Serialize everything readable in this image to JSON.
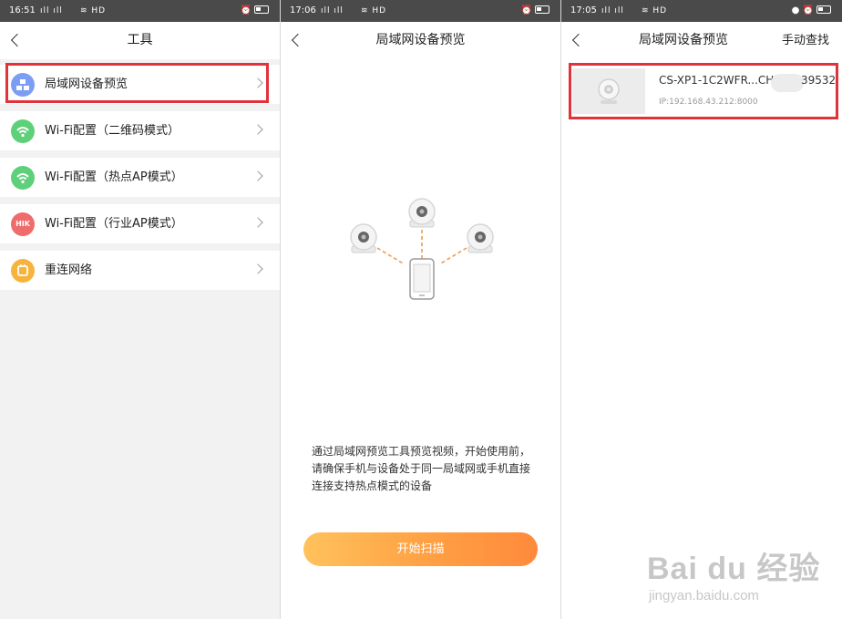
{
  "panels": {
    "left": {
      "status": {
        "time": "16:51",
        "signal": "ıll ıll",
        "right": "⏰"
      },
      "title": "工具",
      "menu": [
        {
          "label": "局域网设备预览",
          "icon": "lan-preview-icon",
          "color": "#7b9df3",
          "highlighted": true
        },
        {
          "label": "Wi-Fi配置（二维码模式）",
          "icon": "wifi-icon",
          "color": "#5ed07a"
        },
        {
          "label": "Wi-Fi配置（热点AP模式）",
          "icon": "wifi-icon",
          "color": "#5ed07a"
        },
        {
          "label": "Wi-Fi配置（行业AP模式）",
          "icon": "hik-icon",
          "icon_text": "HIK",
          "color": "#f06b6b"
        },
        {
          "label": "重连网络",
          "icon": "reconnect-icon",
          "color": "#f7b43c"
        }
      ]
    },
    "middle": {
      "status": {
        "time": "17:06",
        "signal": "ıll ıll",
        "right": "⏰"
      },
      "title": "局域网设备预览",
      "description": "通过局域网预览工具预览视频，开始使用前，请确保手机与设备处于同一局域网或手机直接连接支持热点模式的设备",
      "scan_button": "开始扫描"
    },
    "right": {
      "status": {
        "time": "17:05",
        "signal": "ıll ıll",
        "right": "⏰"
      },
      "title": "局域网设备预览",
      "action": "手动查找",
      "device": {
        "name_left": "CS-XP1-1C2WFR...CH",
        "name_right": "39532",
        "ip": "IP:192.168.43.212:8000"
      }
    }
  },
  "watermark": {
    "main": "Bai du 经验",
    "sub": "jingyan.baidu.com"
  },
  "colors": {
    "highlight": "#e0333a",
    "accent": "#ff9a40",
    "dashed": "#f29a4a"
  }
}
